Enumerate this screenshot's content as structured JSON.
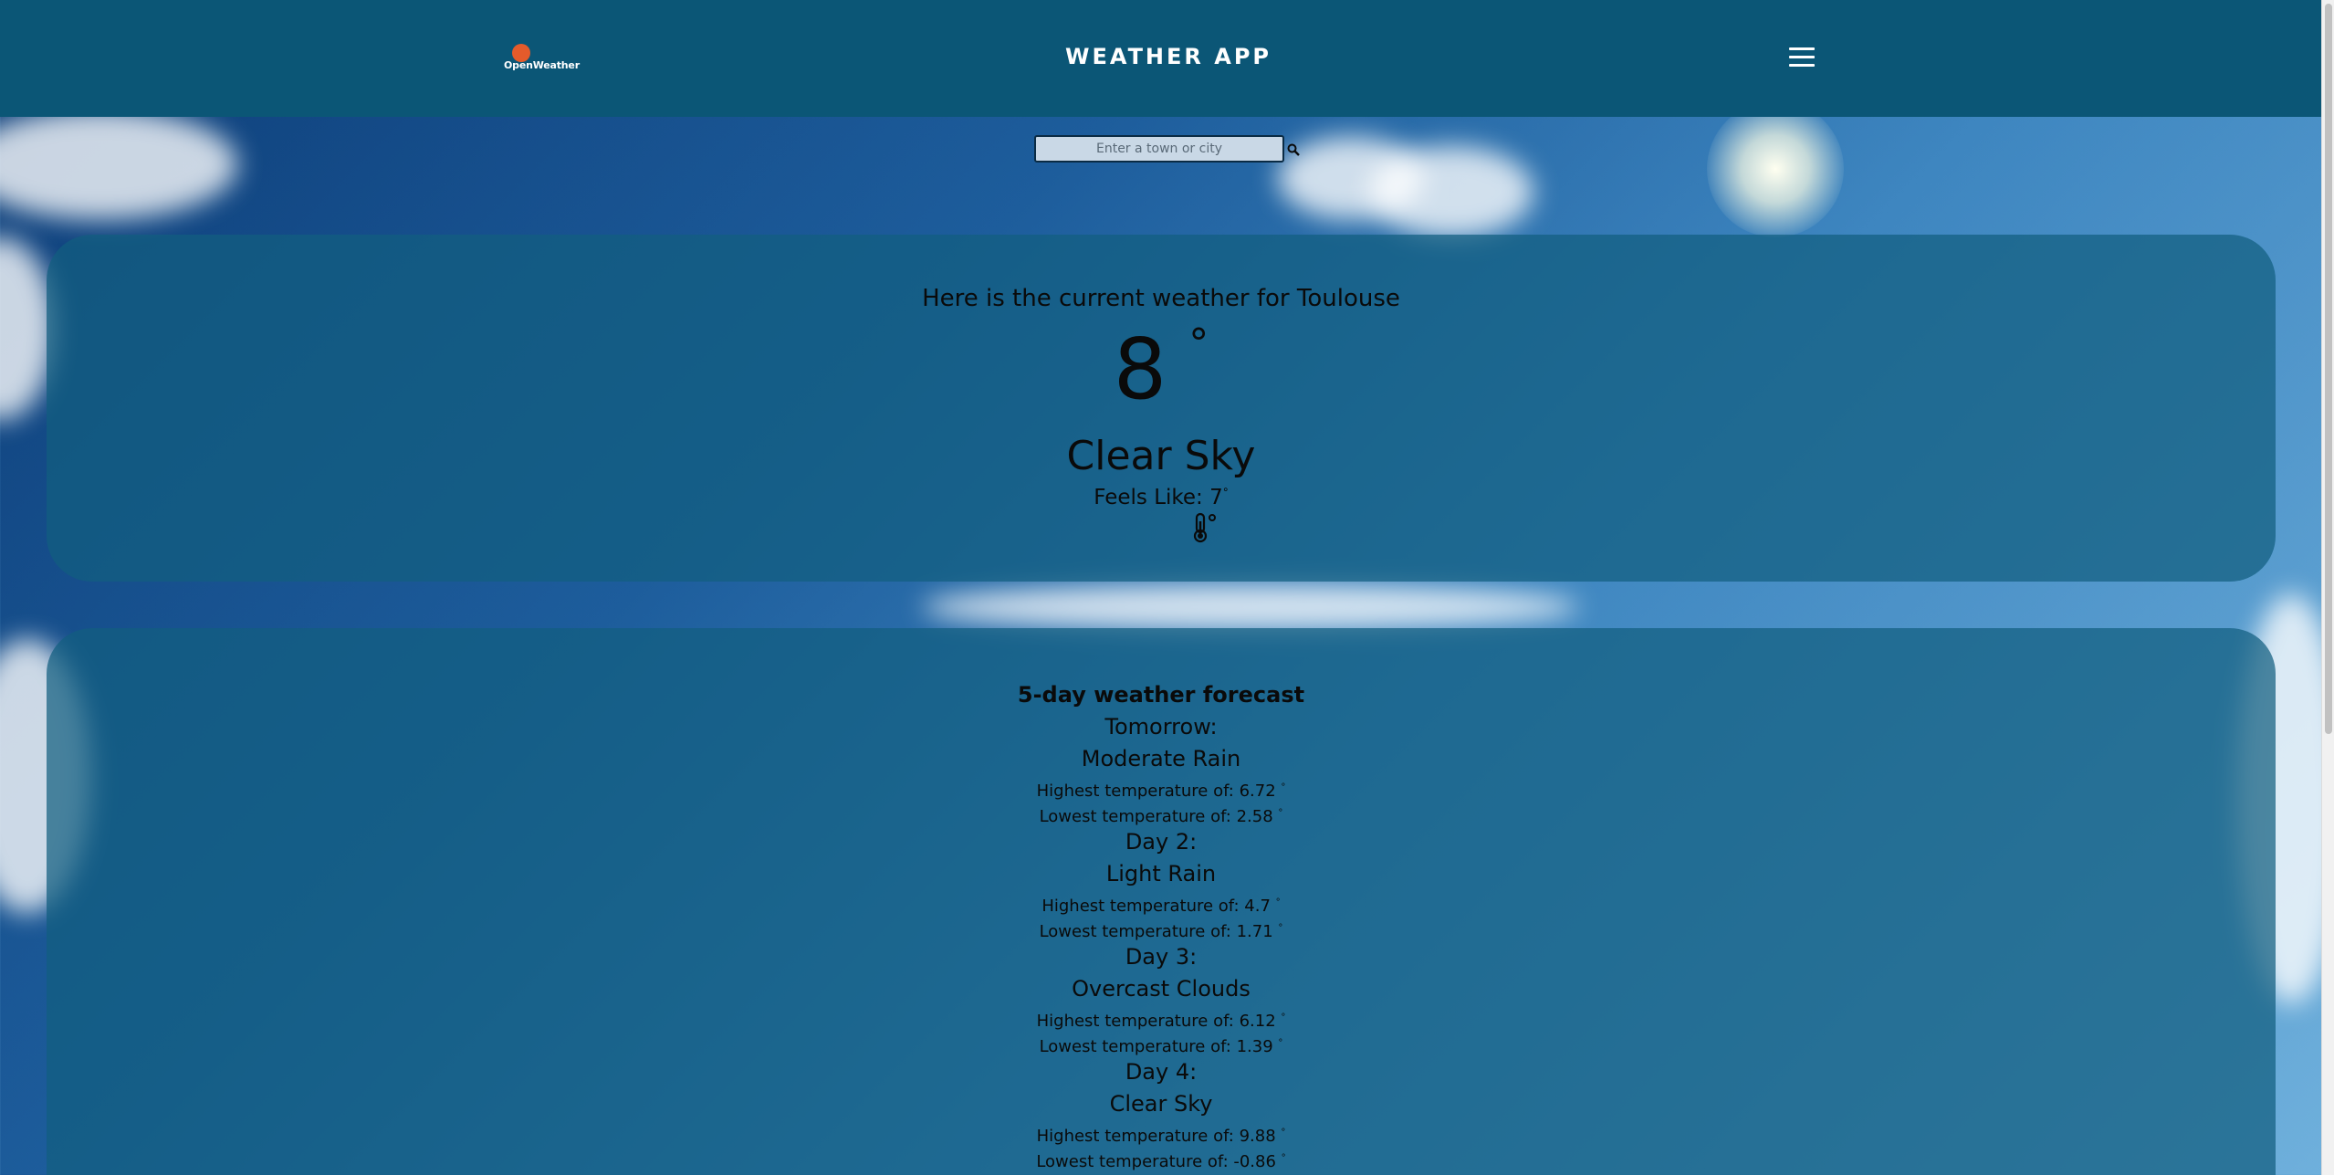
{
  "header": {
    "logo_text": "OpenWeather",
    "title": "WEATHER APP",
    "menu_icon": "hamburger-menu-icon"
  },
  "search": {
    "placeholder": "Enter a town or city",
    "value": "",
    "icon": "search-icon"
  },
  "current": {
    "heading": "Here is the current weather for Toulouse",
    "temperature": "8",
    "degree_symbol": "°",
    "description": "Clear Sky",
    "feels_like_label": "Feels Like: 7",
    "icon": "thermometer-icon"
  },
  "forecast": {
    "title": "5-day weather forecast",
    "days": [
      {
        "label": "Tomorrow:",
        "description": "Moderate Rain",
        "high": "Highest temperature of: 6.72",
        "low": "Lowest temperature of: 2.58"
      },
      {
        "label": "Day 2:",
        "description": "Light Rain",
        "high": "Highest temperature of: 4.7",
        "low": "Lowest temperature of: 1.71"
      },
      {
        "label": "Day 3:",
        "description": "Overcast Clouds",
        "high": "Highest temperature of: 6.12",
        "low": "Lowest temperature of: 1.39"
      },
      {
        "label": "Day 4:",
        "description": "Clear Sky",
        "high": "Highest temperature of: 9.88",
        "low": "Lowest temperature of: -0.86"
      }
    ]
  },
  "colors": {
    "header_bg": "#0b5676",
    "panel_bg": "#125e80",
    "logo_sun": "#e45b2b"
  }
}
